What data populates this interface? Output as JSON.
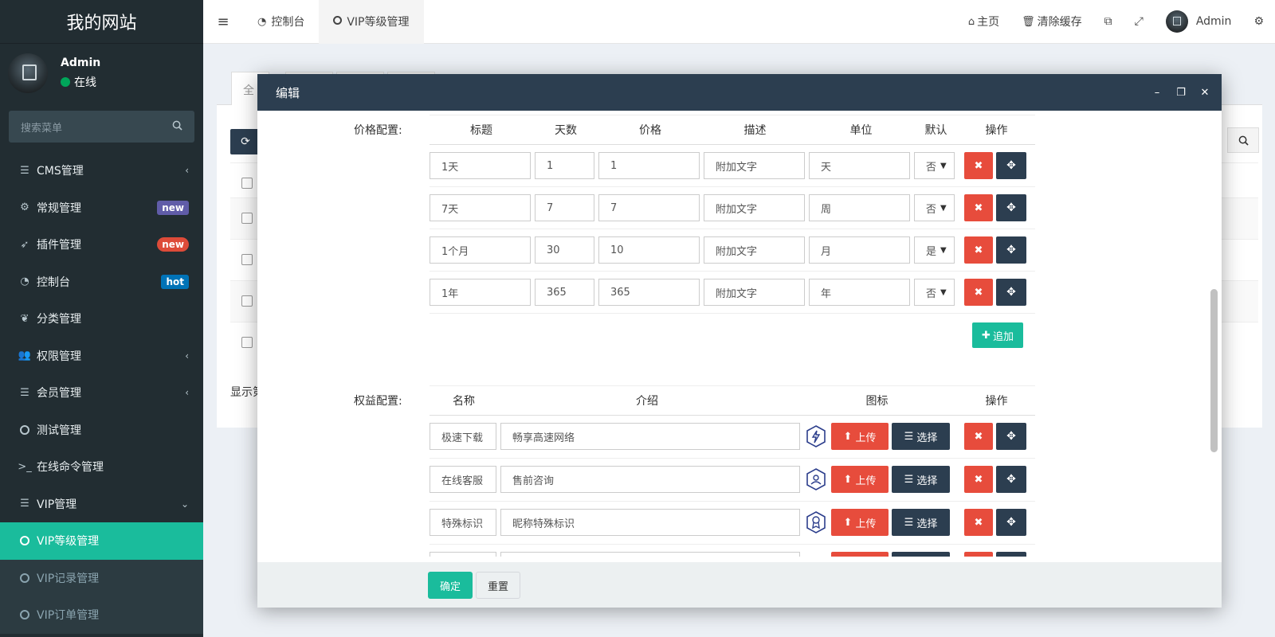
{
  "sidebar": {
    "brand": "我的网站",
    "user": {
      "name": "Admin",
      "status": "在线"
    },
    "search_placeholder": "搜索菜单",
    "items": [
      {
        "label": "CMS管理",
        "icon": "list-icon",
        "chevron": "‹"
      },
      {
        "label": "常规管理",
        "icon": "cogs-icon",
        "badge": "new"
      },
      {
        "label": "插件管理",
        "icon": "rocket-icon",
        "badge": "new"
      },
      {
        "label": "控制台",
        "icon": "dashboard-icon",
        "badge": "hot"
      },
      {
        "label": "分类管理",
        "icon": "leaf-icon"
      },
      {
        "label": "权限管理",
        "icon": "users-icon",
        "chevron": "‹"
      },
      {
        "label": "会员管理",
        "icon": "list-icon",
        "chevron": "‹"
      },
      {
        "label": "测试管理",
        "icon": "circle-icon"
      },
      {
        "label": "在线命令管理",
        "icon": "terminal-icon"
      },
      {
        "label": "VIP管理",
        "icon": "list-icon",
        "chevron": "⌄"
      },
      {
        "label": "VIP等级管理",
        "icon": "circle-icon"
      },
      {
        "label": "VIP记录管理",
        "icon": "circle-icon"
      },
      {
        "label": "VIP订单管理",
        "icon": "circle-icon"
      }
    ]
  },
  "topbar": {
    "tabs": [
      {
        "label": "控制台",
        "icon": "dashboard-icon"
      },
      {
        "label": "VIP等级管理",
        "icon": "circle-icon"
      }
    ],
    "home": "主页",
    "clear_cache": "清除缓存",
    "admin": "Admin"
  },
  "bg": {
    "tab_label": "全",
    "show_label": "显示第"
  },
  "modal": {
    "title": "编辑",
    "price_label": "价格配置:",
    "price_headers": [
      "标题",
      "天数",
      "价格",
      "描述",
      "单位",
      "默认",
      "操作"
    ],
    "price_rows": [
      {
        "title": "1天",
        "days": "1",
        "price": "1",
        "desc": "附加文字",
        "unit": "天",
        "default": "否"
      },
      {
        "title": "7天",
        "days": "7",
        "price": "7",
        "desc": "附加文字",
        "unit": "周",
        "default": "否"
      },
      {
        "title": "1个月",
        "days": "30",
        "price": "10",
        "desc": "附加文字",
        "unit": "月",
        "default": "是"
      },
      {
        "title": "1年",
        "days": "365",
        "price": "365",
        "desc": "附加文字",
        "unit": "年",
        "default": "否"
      }
    ],
    "add_label": "追加",
    "benefit_label": "权益配置:",
    "benefit_headers": [
      "名称",
      "介绍",
      "图标",
      "操作"
    ],
    "benefit_rows": [
      {
        "name": "极速下载",
        "intro": "畅享高速网络",
        "icon": "lightning-badge-icon"
      },
      {
        "name": "在线客服",
        "intro": "售前咨询",
        "icon": "support-badge-icon"
      },
      {
        "name": "特殊标识",
        "intro": "昵称特殊标识",
        "icon": "award-badge-icon"
      }
    ],
    "upload_label": "上传",
    "choose_label": "选择",
    "ok_label": "确定",
    "reset_label": "重置"
  },
  "colors": {
    "sidebar_bg": "#222d32",
    "accent": "#1abc9c",
    "danger": "#e74c3c",
    "dark": "#2c3e50"
  }
}
